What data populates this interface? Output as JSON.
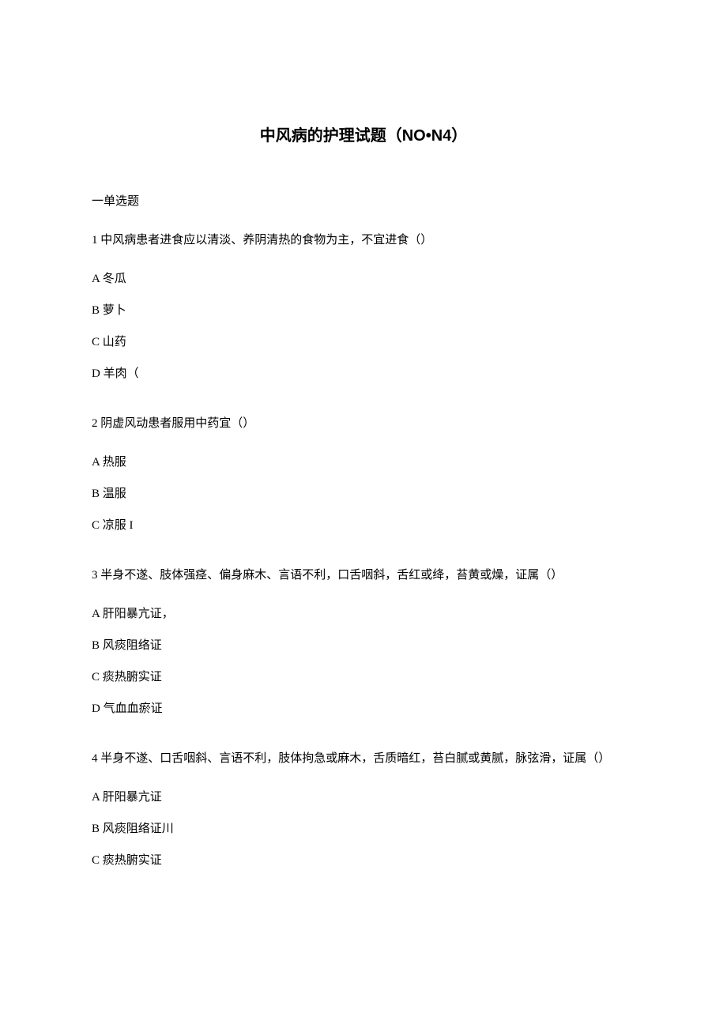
{
  "title": "中风病的护理试题（NO•N4）",
  "section_header": "一单选题",
  "questions": [
    {
      "text": "1 中风病患者进食应以清淡、养阴清热的食物为主，不宜进食（）",
      "options": [
        "A 冬瓜",
        "B 萝卜",
        "C 山药",
        "D 羊肉（"
      ]
    },
    {
      "text": "2 阴虚风动患者服用中药宜（）",
      "options": [
        "A 热服",
        "B 温服",
        "C 凉服 I"
      ]
    },
    {
      "text": "3 半身不遂、肢体强痉、偏身麻木、言语不利，口舌咽斜，舌红或绛，苔黄或燥，证属（）",
      "options": [
        "A 肝阳暴亢证，",
        "B 风痰阻络证",
        "C 痰热腑实证",
        "D 气血血瘀证"
      ]
    },
    {
      "text": "4 半身不遂、口舌咽斜、言语不利，肢体拘急或麻木，舌质暗红，苔白腻或黄腻，脉弦滑，证属（）",
      "options": [
        "A 肝阳暴亢证",
        "B 风痰阻络证川",
        "C 痰热腑实证"
      ]
    }
  ]
}
